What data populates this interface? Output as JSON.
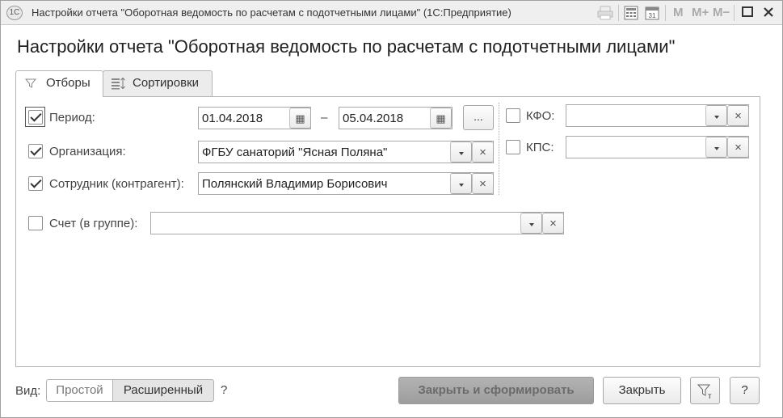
{
  "window": {
    "title": "Настройки отчета \"Оборотная ведомость по расчетам с подотчетными лицами\"  (1С:Предприятие)",
    "logo": "1С",
    "toolbar": {
      "m_label": "M",
      "m_plus_label": "M+",
      "m_minus_label": "M−",
      "calendar_day": "31"
    }
  },
  "page": {
    "title": "Настройки отчета \"Оборотная ведомость по расчетам с подотчетными лицами\""
  },
  "tabs": [
    {
      "label": "Отборы",
      "icon": "filter-icon",
      "active": true
    },
    {
      "label": "Сортировки",
      "icon": "sort-icon",
      "active": false
    }
  ],
  "filters": {
    "period": {
      "label": "Период:",
      "checked": true,
      "from": "01.04.2018",
      "dash": "–",
      "to": "05.04.2018",
      "dots_label": "..."
    },
    "organization": {
      "label": "Организация:",
      "checked": true,
      "value": "ФГБУ санаторий \"Ясная Поляна\""
    },
    "employee": {
      "label": "Сотрудник (контрагент):",
      "checked": true,
      "value": "Полянский Владимир Борисович"
    },
    "account": {
      "label": "Счет (в группе):",
      "checked": false,
      "value": ""
    },
    "kfo": {
      "label": "КФО:",
      "checked": false,
      "value": ""
    },
    "kps": {
      "label": "КПС:",
      "checked": false,
      "value": ""
    }
  },
  "glyphs": {
    "clear": "×",
    "calendar": "▦"
  },
  "footer": {
    "view_label": "Вид:",
    "view_simple": "Простой",
    "view_advanced": "Расширенный",
    "view_help": "?",
    "generate_button": "Закрыть и сформировать",
    "close_button": "Закрыть",
    "help_button": "?"
  }
}
